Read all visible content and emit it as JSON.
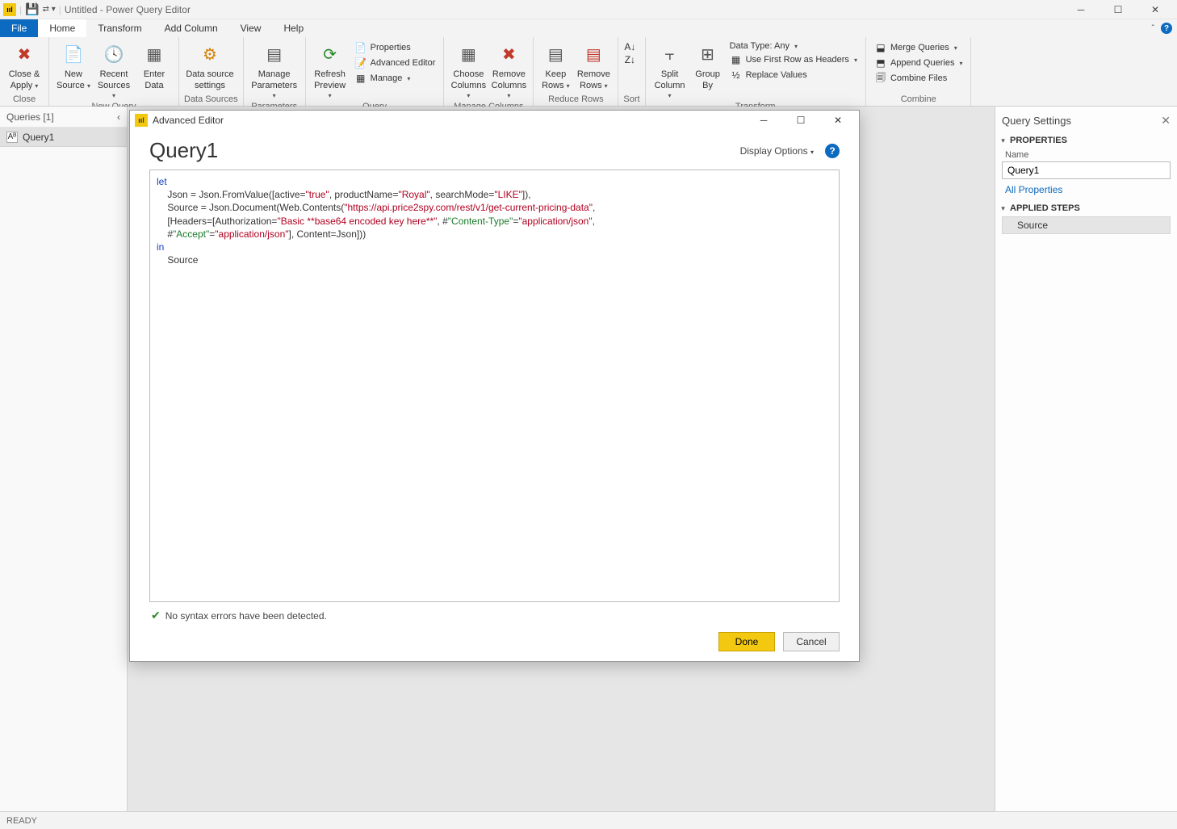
{
  "titlebar": {
    "title": "Untitled - Power Query Editor"
  },
  "tabs": {
    "file": "File",
    "home": "Home",
    "transform": "Transform",
    "addcolumn": "Add Column",
    "view": "View",
    "help": "Help"
  },
  "ribbon": {
    "close": {
      "label1": "Close &",
      "label2": "Apply",
      "group": "Close"
    },
    "newquery": {
      "new_source1": "New",
      "new_source2": "Source",
      "recent1": "Recent",
      "recent2": "Sources",
      "enter1": "Enter",
      "enter2": "Data",
      "group": "New Query"
    },
    "datasources": {
      "ds1": "Data source",
      "ds2": "settings",
      "group": "Data Sources"
    },
    "parameters": {
      "p1": "Manage",
      "p2": "Parameters",
      "group": "Parameters"
    },
    "query": {
      "refresh1": "Refresh",
      "refresh2": "Preview",
      "properties": "Properties",
      "advanced": "Advanced Editor",
      "manage": "Manage",
      "group": "Query"
    },
    "managecols": {
      "choose1": "Choose",
      "choose2": "Columns",
      "remove1": "Remove",
      "remove2": "Columns",
      "group": "Manage Columns"
    },
    "reducerows": {
      "keep1": "Keep",
      "keep2": "Rows",
      "remove1": "Remove",
      "remove2": "Rows",
      "group": "Reduce Rows"
    },
    "sort": {
      "group": "Sort"
    },
    "transform": {
      "split1": "Split",
      "split2": "Column",
      "group1": "Group",
      "group2": "By",
      "datatype": "Data Type: Any",
      "firstrow": "Use First Row as Headers",
      "replace": "Replace Values",
      "group": "Transform"
    },
    "combine": {
      "merge": "Merge Queries",
      "append": "Append Queries",
      "combinefiles": "Combine Files",
      "group": "Combine"
    }
  },
  "queries": {
    "header": "Queries [1]",
    "item": "Query1"
  },
  "settings": {
    "title": "Query Settings",
    "properties": "PROPERTIES",
    "name_label": "Name",
    "name_value": "Query1",
    "all_properties": "All Properties",
    "applied_steps": "APPLIED STEPS",
    "step": "Source"
  },
  "dialog": {
    "title": "Advanced Editor",
    "query_name": "Query1",
    "display_options": "Display Options",
    "code": {
      "l1a": "let",
      "l2a": "    Json = Json.FromValue([active=",
      "l2s1": "\"true\"",
      "l2b": ", productName=",
      "l2s2": "\"Royal\"",
      "l2c": ", searchMode=",
      "l2s3": "\"LIKE\"",
      "l2d": "]),",
      "l3a": "    Source = Json.Document(Web.Contents(",
      "l3s1": "\"https://api.price2spy.com/rest/v1/get-current-pricing-data\"",
      "l3b": ",",
      "l4a": "    [Headers=[Authorization=",
      "l4s1": "\"Basic **base64 encoded key here**\"",
      "l4b": ", #",
      "l4s2": "\"Content-Type\"",
      "l4c": "=",
      "l4s3": "\"application/json\"",
      "l4d": ",",
      "l5a": "    #",
      "l5s1": "\"Accept\"",
      "l5b": "=",
      "l5s2": "\"application/json\"",
      "l5c": "], Content=Json]))",
      "l6a": "in",
      "l7a": "    Source"
    },
    "syntax_ok": "No syntax errors have been detected.",
    "done": "Done",
    "cancel": "Cancel"
  },
  "status": "READY"
}
